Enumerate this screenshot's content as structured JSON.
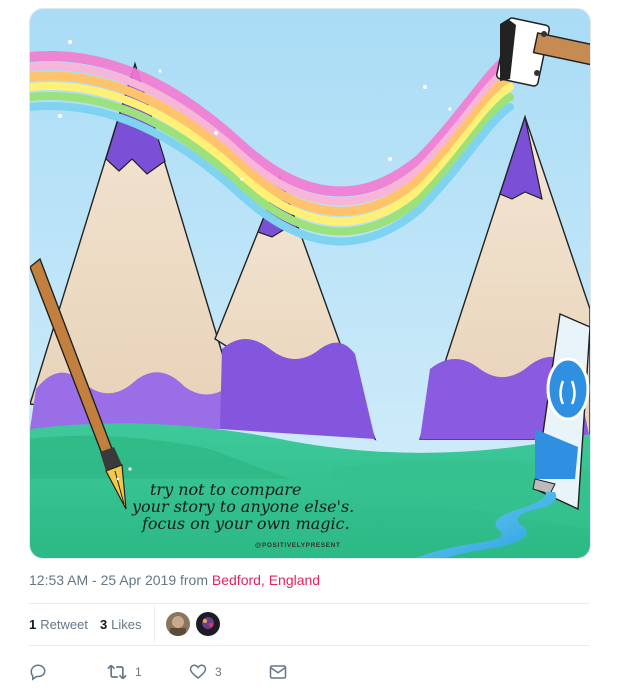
{
  "tweet": {
    "media": {
      "quote_line1": "try not to compare",
      "quote_line2": "your story to anyone else's.",
      "quote_line3": "focus on your own magic.",
      "watermark": "@POSITIVELYPRESENT"
    },
    "timestamp": {
      "time_date": "12:53 AM - 25 Apr 2019",
      "from_label": "from",
      "location": "Bedford, England"
    },
    "stats": {
      "retweet_count": "1",
      "retweet_label": "Retweet",
      "like_count": "3",
      "like_label": "Likes"
    },
    "actions": {
      "retweet_count": "1",
      "like_count": "3"
    },
    "colors": {
      "location_link": "#e0245e",
      "muted_text": "#657786"
    }
  }
}
